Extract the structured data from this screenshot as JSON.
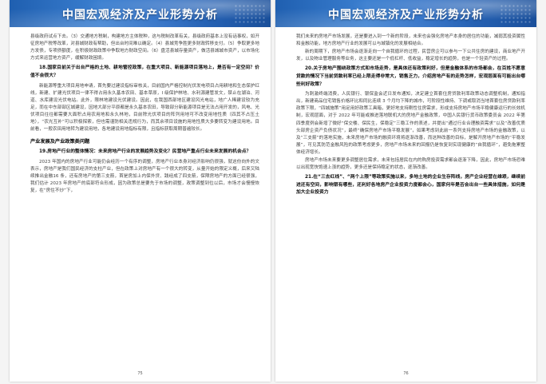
{
  "left_page": {
    "banner_title": "中国宏观经济及产业形势分析",
    "blocks": [
      {
        "type": "para",
        "noindent": true,
        "text": "县级政府试点下去。（3）交通地方税制，构建地方主体税种，这与税制改革有关，县级政府基本上没有话事权，如开征房地产税等改革，对县城财政有帮助，但出台时间难以确定。（4）县城竞争胜更多财政转移支付。（5）争取更多地方发债，专项债额度，在积极财政政策中争取地方财政空间。（6）盘活县城存量资产，做活县城城市资产，以市场化方式来运营地方资产，缓解财政困境。"
      },
      {
        "type": "q",
        "text": "18.国家目前关于出台严格的土地、耕地管控政策，在重大项目、新能源项目落地上，是否有一定空间？价值不会很大？"
      },
      {
        "type": "para",
        "text": "新能源等重大项目用地申请，首先要过建设指标审核关，目前国内严格控制光伏发电项目占用耕地和生态保护红线，新建、扩建光伏项目一律不得占用永久基本农田、基本草原，I 级保护林地、水利源建管发文，禁止在湖泊、河道、水库建设光伏电站。此外，限林地建设光伏建设。因此，在我国西部地区建设风光电站，地广人稀建设较为充足，而在中东部部区城建设，因地大部分平原都是永久基本农田，导致部分新能源项目是无法占用开发的，风电、光伏项目往往都需要大面积占用农用地和永久林地，目前除光伏项目的阵列用地可不改变用地性质（四其不占压土地），“农光互补”可以积极探索，但也需谨防相关违规行为，而其余项目设施的用地性质大多要转变为建设用地。目前看，一般农田用地转为建设用地，各地建设用地指标有限，且指标获取周期普遍较长。"
      },
      {
        "type": "section",
        "text": "产业发展及产业政策类问题"
      },
      {
        "type": "q",
        "text": "19.房地产行业的整体情况：未来房地产行业的发展趋势及变化？民营地产重点行业未来发展的机会点？"
      },
      {
        "type": "para",
        "text": "2023 年国内的房地产行业可能仍会经历一个有序的调整，房地产行业本身对经济影响仍很强，就这份向外的文表示，房地产是我们国民经济的支柱产业，但在政策上对房地产有一个很大的转变，从量开始的限定义概，后来又陆续推出金融16 条，还有房地产的第三支箭，首是房加上内保外贷、践经成了四支箭，保障房地产的方面已经很强，我们估计 2023 年房地产的底部符合形成，因为政策总是要先于市场的调整，政策调整到位以后，市场才会慢慢恢复，在“房住不炒”下，"
      }
    ],
    "page_number": "75"
  },
  "right_page": {
    "banner_title": "中国宏观经济及产业形势分析",
    "blocks": [
      {
        "type": "para",
        "noindent": true,
        "text": "我们未来的房地产市场发展，还是要进入到一个新的阶段，未来也会强化房地产本身的居住的功能，减弱其投资属性和金融功能，地方房地产行业的发展可以与城镇化的发展相结合。"
      },
      {
        "type": "para",
        "text": "新的周期下，房地产市场会逐渐走向一个自我循环的过程，民营房企可以参与一下公共住房的建设，商业地产开发，以及物业管理服务等业务，这主要还是一个低杠杆、低收益，稳定增长的趋势，也是一个轻资产的过程。"
      },
      {
        "type": "q",
        "text": "20.关于房地产围绕政策方式和市场走势，是具体还有政策利好，但是金融体系的市场都会，在百姓不愿意贷款的情况下当前贷款利率已经上限走得非常大，销售乏力，介绍房地产有的走势怎样，宏观层面有可能出台哪些利好政策？"
      },
      {
        "type": "para",
        "text": "为刺激终端消费，人民银行、银保监会近日发布通知，决定建立首套住房贷款利率政策动态调整机制，通知指出，新建商品住宅销售价格环比和同比连续 3 个月均下降的城市，可阶段性维持、下调或取消当地首套住房贷款利率政策下限，“四城施策”用足用好政策工具箱，更好地支持刚性住房需求，形成支持房地产市场平稳健康运行的长效机制，宏观层面，对于 2022 年可能或推进落地联机大的房地产金融政策，中国人民银行货币政策委员会 2022 年第四季度例会新增了微好“保交楼、保民生，保稳定”三稳工作的表述，并提出“通过行业合理融资需求”以及“改善优质头部房企资产负债状况”，最终“确保房地产市场平稳发展”，如果考虑到此前一系列支持房地产市场的金融政策，以及“三支箭”的落地实施，未来房地产市场的融资环境将逐渐改善，而这种改善的目标，是解开房地产市场的“平稳发展”，可见其防范金融风险的政策考虑更多，房地产市场未来的回报仍是恢复到实现健康的“自我循环”，避免拖累整体经济增长。"
      },
      {
        "type": "para",
        "text": "房地产市场未来要更多调整居住需求，未来包括居民在内的购房投资需求都会逐渐下降，因此，房地产市场恐难以出现宽快饱速上涨的趋势，更多还是保持稳定的状态，逐渐改善。"
      },
      {
        "type": "q",
        "text": "21.在“三去红线”、“两个上限”等政策实施以来，多地土地的企业生存阵线，房产企业经营在维艰，继续前进还有空间，影响银有哪些，还利好各地房产企业投资力度都会心，国家何年是否会出台一些具体措施，如何是加大企业投资力"
      }
    ],
    "page_number": "76"
  },
  "colors": {
    "banner_start": "#1f5fb0",
    "banner_end": "#1a4f9a",
    "page_bg": "#ffffff",
    "viewer_bg": "#f4f4f4"
  }
}
